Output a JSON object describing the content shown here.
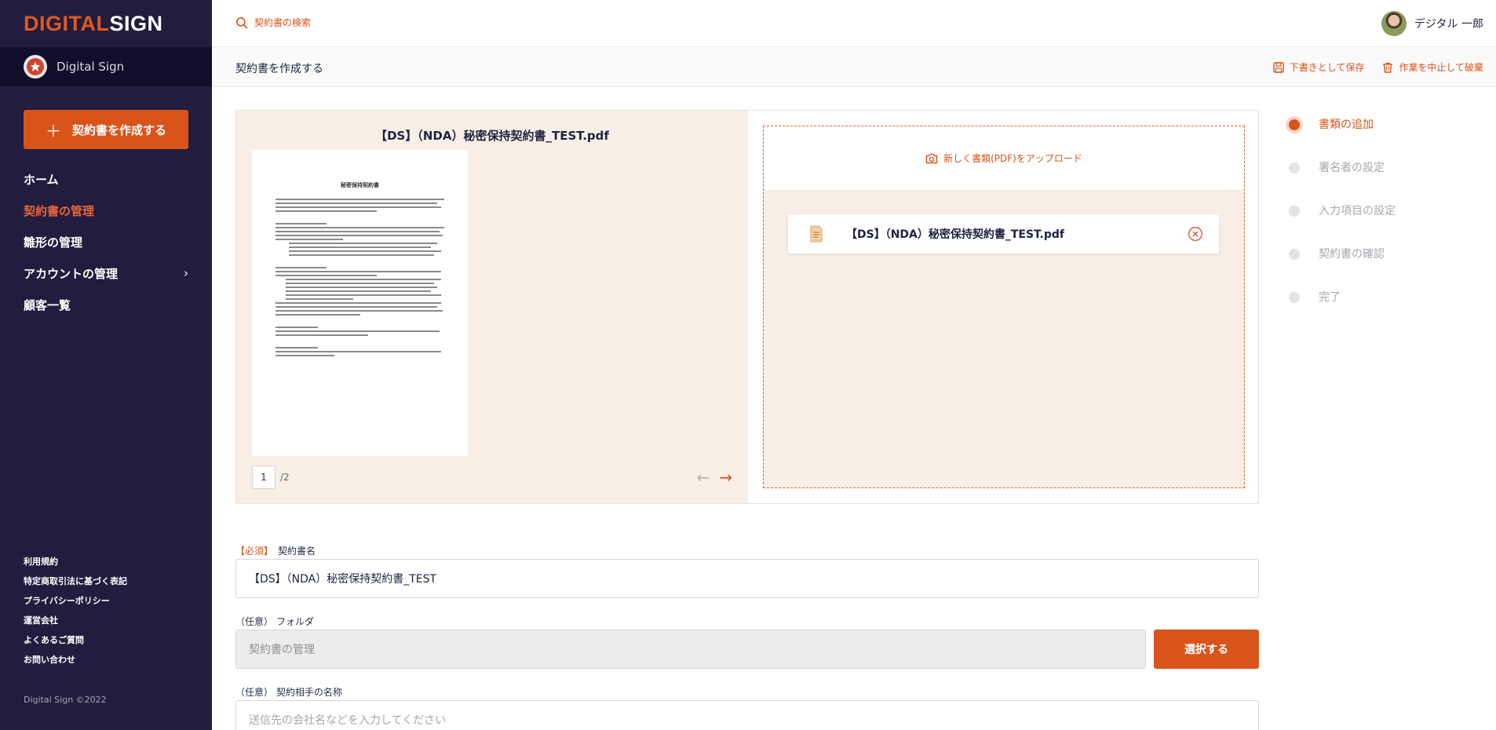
{
  "logo": {
    "part1": "DIGITAL",
    "part2": "SIGN"
  },
  "brand": {
    "name": "Digital Sign"
  },
  "sidebar": {
    "create_button": "契約書を作成する",
    "nav": [
      {
        "label": "ホーム",
        "active": false
      },
      {
        "label": "契約書の管理",
        "active": true
      },
      {
        "label": "雛形の管理",
        "active": false
      },
      {
        "label": "アカウントの管理",
        "active": false,
        "has_submenu": true
      },
      {
        "label": "顧客一覧",
        "active": false
      }
    ],
    "footer_links": [
      "利用規約",
      "特定商取引法に基づく表記",
      "プライバシーポリシー",
      "運営会社",
      "よくあるご質問",
      "お問い合わせ"
    ],
    "copyright": "Digital Sign ©2022"
  },
  "topbar": {
    "search_label": "契約書の検索",
    "user_name": "デジタル 一郎"
  },
  "pagehead": {
    "title": "契約書を作成する",
    "save_draft": "下書きとして保存",
    "cancel": "作業を中止して破棄"
  },
  "preview": {
    "file_title": "【DS】（NDA）秘密保持契約書_TEST.pdf",
    "doc_heading": "秘密保持契約書",
    "current_page": "1",
    "total_pages": "/2"
  },
  "upload": {
    "label": "新しく書類(PDF)をアップロード",
    "file_name": "【DS】（NDA）秘密保持契約書_TEST.pdf"
  },
  "steps": [
    {
      "label": "書類の追加",
      "active": true
    },
    {
      "label": "署名者の設定",
      "active": false
    },
    {
      "label": "入力項目の設定",
      "active": false
    },
    {
      "label": "契約書の確認",
      "active": false
    },
    {
      "label": "完了",
      "active": false
    }
  ],
  "form": {
    "contract_name": {
      "required_tag": "【必須】",
      "label": "契約書名",
      "value": "【DS】（NDA）秘密保持契約書_TEST"
    },
    "folder": {
      "optional_tag": "（任意）",
      "label": "フォルダ",
      "value": "契約書の管理",
      "select_button": "選択する"
    },
    "counterparty": {
      "optional_tag": "（任意）",
      "label": "契約相手の名称",
      "placeholder": "送信先の会社名などを入力してください"
    }
  },
  "colors": {
    "accent": "#d9541a",
    "sidebar_bg": "#221c3e",
    "panel_bg": "#f7efe6"
  }
}
